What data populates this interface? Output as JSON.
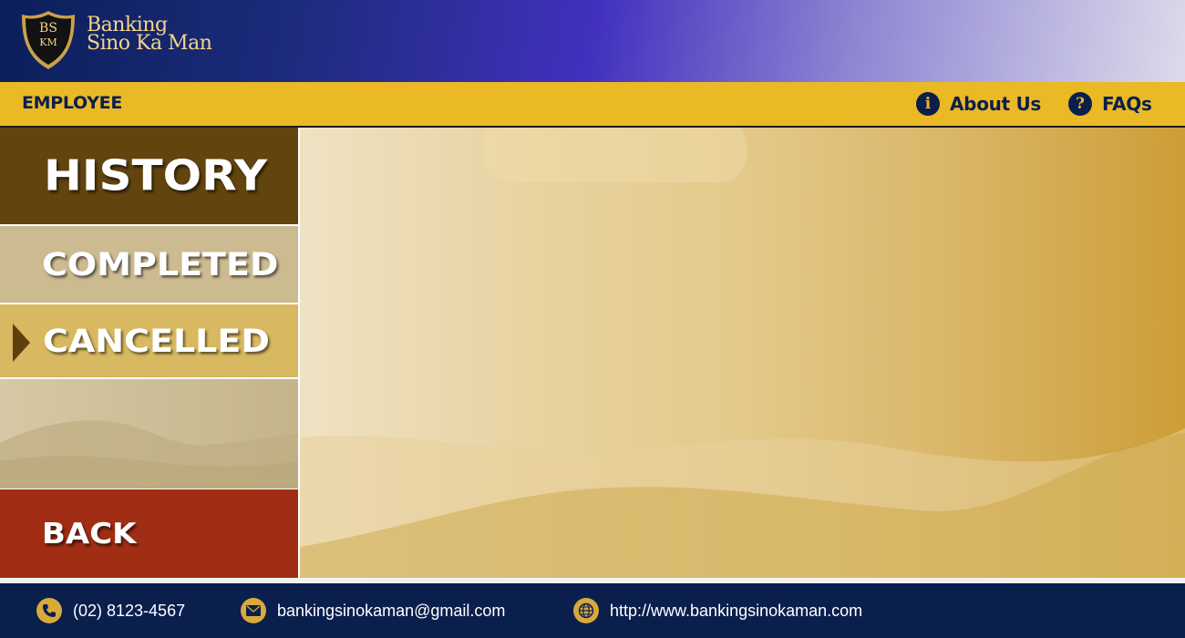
{
  "brand": {
    "logo_monogram_top": "BS",
    "logo_monogram_bottom": "KM",
    "name_line1": "Banking",
    "name_line2": "Sino Ka Man"
  },
  "navbar": {
    "role": "EMPLOYEE",
    "links": [
      {
        "label": "About Us",
        "icon": "info-icon",
        "glyph": "i"
      },
      {
        "label": "FAQs",
        "icon": "question-icon",
        "glyph": "?"
      }
    ]
  },
  "sidebar": {
    "title": "HISTORY",
    "items": [
      {
        "label": "COMPLETED",
        "active": false
      },
      {
        "label": "CANCELLED",
        "active": true
      }
    ],
    "back_label": "BACK"
  },
  "footer": {
    "phone": "(02) 8123-4567",
    "email": "bankingsinokaman@gmail.com",
    "website": "http://www.bankingsinokaman.com"
  },
  "colors": {
    "header_gradient_start": "#0b1f5a",
    "header_gradient_end": "#dcdbea",
    "navbar": "#ebb926",
    "navy": "#0b1f4d",
    "sidebar_title": "#62440f",
    "completed_bg": "#ccba91",
    "cancelled_bg": "#d8b860",
    "back_bg": "#a12e14"
  }
}
